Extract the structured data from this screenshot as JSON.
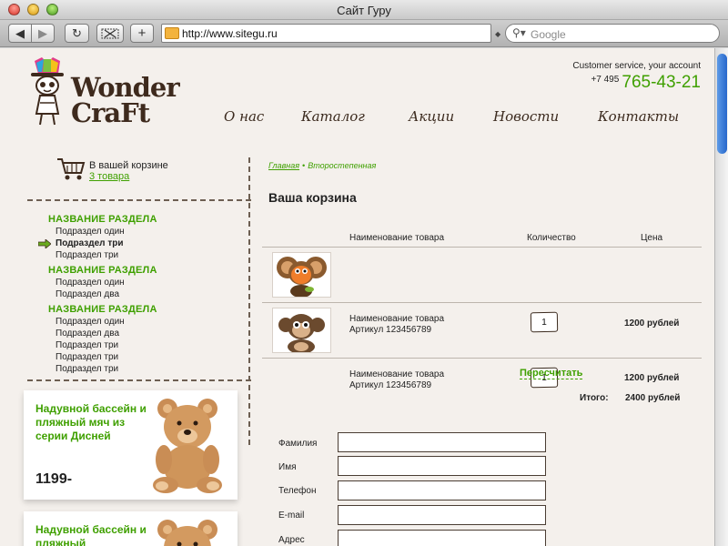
{
  "window": {
    "title": "Сайт Гуру"
  },
  "browser": {
    "url": "http://www.sitegu.ru",
    "search_placeholder": "Google",
    "back_glyph": "◀",
    "forward_glyph": "▶",
    "reload_glyph": "↻",
    "add_glyph": "+"
  },
  "header": {
    "logo_line1": "Wonder",
    "logo_line2": "CraFt",
    "customer_service": "Customer service, your account",
    "phone_code": "+7 495",
    "phone_number": "765-43-21",
    "nav": [
      "О нас",
      "Каталог",
      "Акции",
      "Новости",
      "Контакты"
    ]
  },
  "sidebar": {
    "cart_label": "В вашей корзине",
    "cart_count": "3 товара",
    "categories": [
      {
        "title": "НАЗВАНИЕ РАЗДЕЛА",
        "items": [
          "Подраздел один",
          "Подраздел три",
          "Подраздел три"
        ]
      },
      {
        "title": "НАЗВАНИЕ РАЗДЕЛА",
        "items": [
          "Подраздел один",
          "Подраздел два"
        ]
      },
      {
        "title": "НАЗВАНИЕ РАЗДЕЛА",
        "items": [
          "Подраздел один",
          "Подраздел два",
          "Подраздел три",
          "Подраздел три",
          "Подраздел три"
        ]
      }
    ],
    "promos": [
      {
        "text": "Надувной бассейн и пляжный мяч из серии Дисней",
        "price": "1199-"
      },
      {
        "text": "Надувной бассейн и пляжный",
        "price": ""
      }
    ]
  },
  "main": {
    "breadcrumbs": [
      "Главная",
      "Второстепенная"
    ],
    "title": "Ваша корзина",
    "columns": {
      "name": "Наименование товара",
      "qty": "Количество",
      "price": "Цена"
    },
    "items": [
      {
        "name": "Наименование товара",
        "sku": "Артикул 123456789",
        "qty": "1",
        "price": "1200 рублей"
      },
      {
        "name": "Наименование товара",
        "sku": "Артикул 123456789",
        "qty": "1",
        "price": "1200 рублей"
      }
    ],
    "recalc": "Пересчитать",
    "total_label": "Итого:",
    "total_value": "2400 рублей",
    "form": {
      "fields": [
        "Фамилия",
        "Имя",
        "Телефон",
        "E-mail",
        "Адрес"
      ]
    }
  }
}
